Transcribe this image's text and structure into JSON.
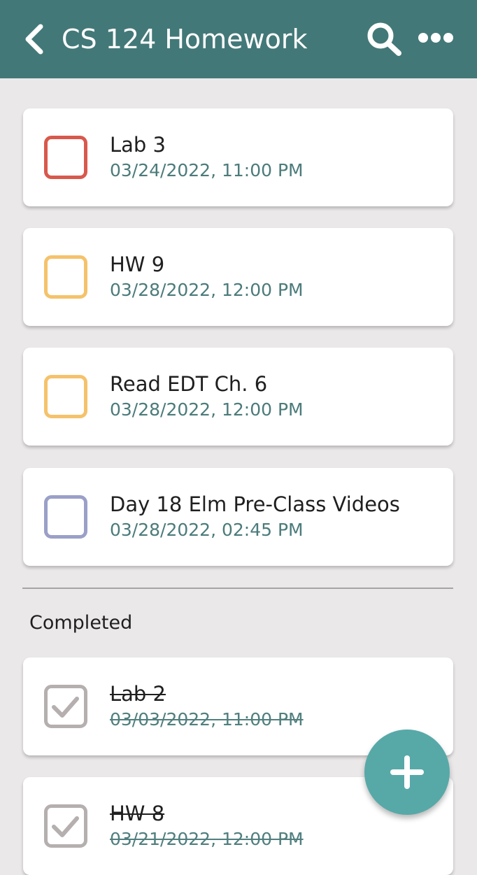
{
  "header": {
    "title": "CS 124 Homework",
    "back_icon": "chevron-left-icon",
    "search_icon": "search-icon",
    "more_icon": "more-horizontal-icon",
    "background_color": "#437878"
  },
  "tasks": [
    {
      "name": "Lab 3",
      "due": "03/24/2022, 11:00 PM",
      "completed": false,
      "color": "#d8594c"
    },
    {
      "name": "HW 9",
      "due": "03/28/2022, 12:00 PM",
      "completed": false,
      "color": "#f5c26b"
    },
    {
      "name": "Read EDT Ch. 6",
      "due": "03/28/2022, 12:00 PM",
      "completed": false,
      "color": "#f5c26b"
    },
    {
      "name": "Day 18 Elm Pre-Class Videos",
      "due": "03/28/2022, 02:45 PM",
      "completed": false,
      "color": "#9aa0c8"
    }
  ],
  "completed_section": {
    "label": "Completed",
    "items": [
      {
        "name": "Lab 2",
        "due": "03/03/2022, 11:00 PM",
        "completed": true,
        "color": "#b5afaf"
      },
      {
        "name": "HW 8",
        "due": "03/21/2022, 12:00 PM",
        "completed": true,
        "color": "#b5afaf"
      }
    ]
  },
  "fab": {
    "icon": "plus-icon",
    "color": "#57a9a8"
  }
}
